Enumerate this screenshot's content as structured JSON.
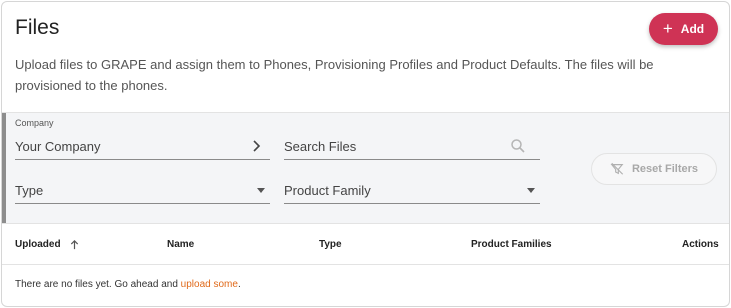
{
  "page": {
    "title": "Files",
    "add_label": "Add",
    "description": "Upload files to GRAPE and assign them to Phones, Provisioning Profiles and Product Defaults. The files will be provisioned to the phones."
  },
  "filters": {
    "company": {
      "label": "Company",
      "value": "Your Company"
    },
    "search": {
      "placeholder": "Search Files"
    },
    "type": {
      "value": "Type"
    },
    "product_family": {
      "value": "Product Family"
    },
    "reset_label": "Reset Filters"
  },
  "table": {
    "columns": [
      "Uploaded",
      "Name",
      "Type",
      "Product Families",
      "Actions"
    ],
    "empty_text": "There are no files yet. Go ahead and ",
    "empty_link": "upload some",
    "empty_suffix": "."
  },
  "colors": {
    "accent": "#cf3355",
    "link": "#e06a1b",
    "filter_bg": "#f4f5f7"
  },
  "icons": {
    "add": "plus-icon",
    "company": "chevron-right-icon",
    "search": "search-icon",
    "dropdown": "caret-down-icon",
    "reset": "filter-off-icon",
    "sort": "arrow-up-icon"
  }
}
